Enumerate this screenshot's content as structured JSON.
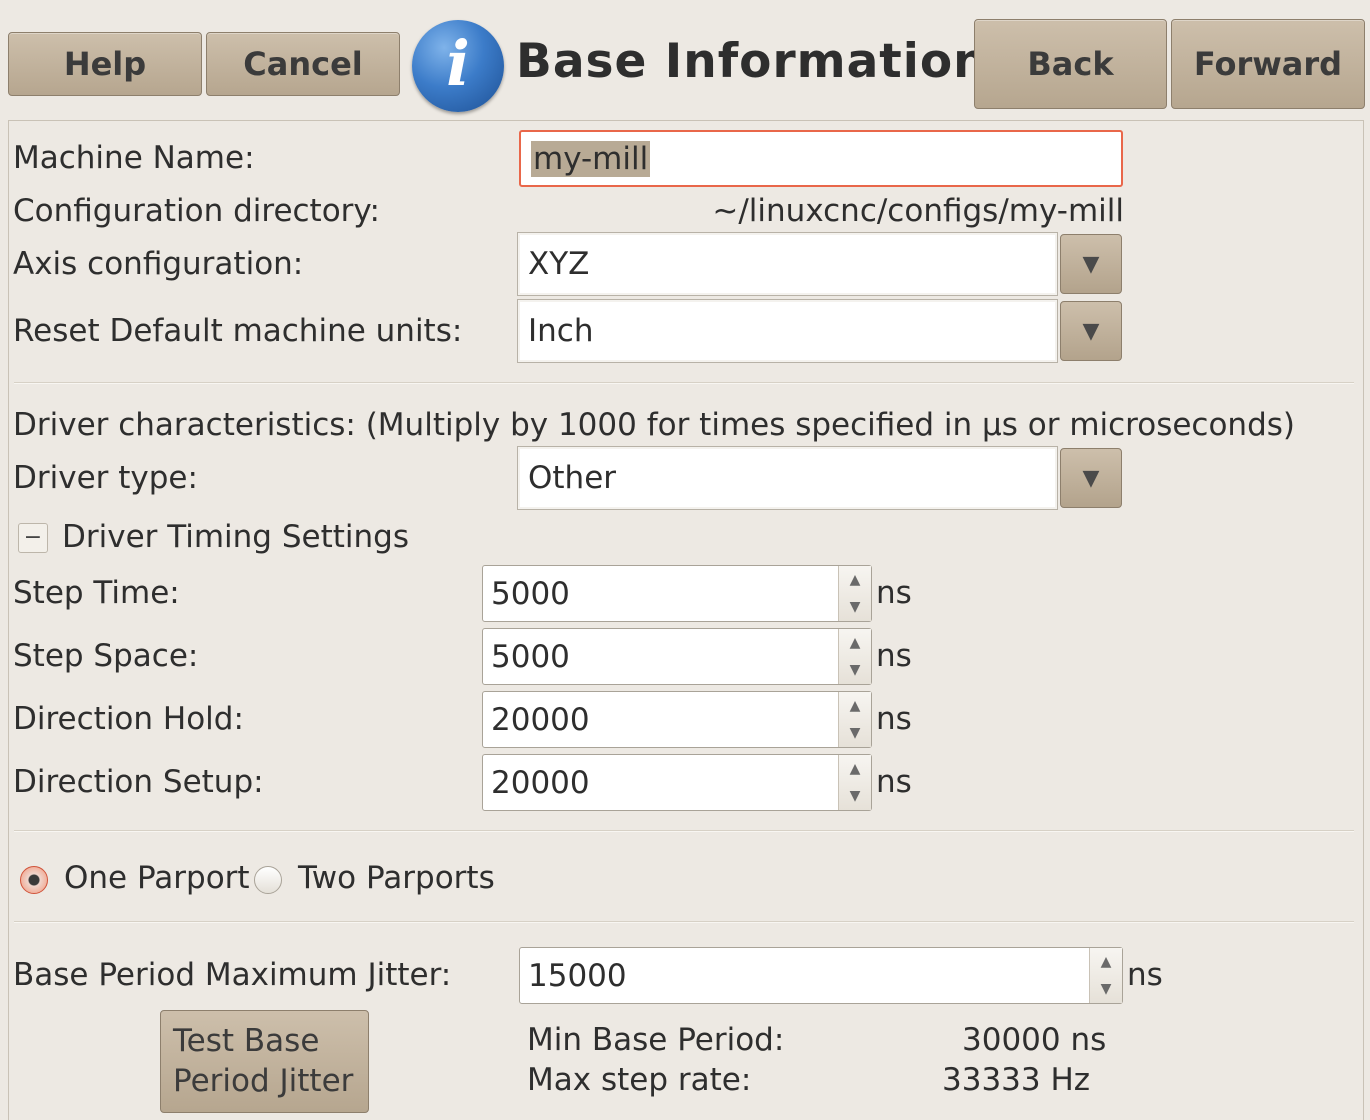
{
  "toolbar": {
    "help_label": "Help",
    "cancel_label": "Cancel",
    "back_label": "Back",
    "forward_label": "Forward",
    "icon": "info-icon",
    "icon_glyph": "i",
    "title": "Base Information"
  },
  "form": {
    "machine_name_label": "Machine Name:",
    "machine_name_value": "my-mill",
    "config_dir_label": "Configuration directory:",
    "config_dir_value": "~/linuxcnc/configs/my-mill",
    "axis_config_label": "Axis configuration:",
    "axis_config_value": "XYZ",
    "units_label": "Reset Default machine units:",
    "units_value": "Inch",
    "driver_characteristics": "Driver characteristics: (Multiply by 1000 for times specified in µs or microseconds)",
    "driver_type_label": "Driver type:",
    "driver_type_value": "Other",
    "timing_expander_glyph": "−",
    "timing_expander_label": "Driver Timing Settings"
  },
  "timing": [
    {
      "label": "Step Time:",
      "value": "5000",
      "unit": "ns"
    },
    {
      "label": "Step Space:",
      "value": "5000",
      "unit": "ns"
    },
    {
      "label": "Direction Hold:",
      "value": "20000",
      "unit": "ns"
    },
    {
      "label": "Direction Setup:",
      "value": "20000",
      "unit": "ns"
    }
  ],
  "parport": {
    "one_label": "One Parport",
    "two_label": "Two Parports",
    "selected": "One Parport"
  },
  "jitter": {
    "label": "Base Period Maximum Jitter:",
    "value": "15000",
    "unit": "ns",
    "test_button_line1": "Test Base",
    "test_button_line2": "Period Jitter",
    "min_base_period_label": "Min Base Period:",
    "min_base_period_value": "30000 ns",
    "max_step_rate_label": "Max step rate:",
    "max_step_rate_value": "33333 Hz"
  },
  "glyphs": {
    "dropdown_arrow": "▼",
    "spin_up": "▲",
    "spin_down": "▼"
  },
  "colors": {
    "button": "#c3b49f",
    "focus_border": "#e9674a",
    "radio_selected": "#f29579",
    "info_icon": "#3c7cc9"
  }
}
